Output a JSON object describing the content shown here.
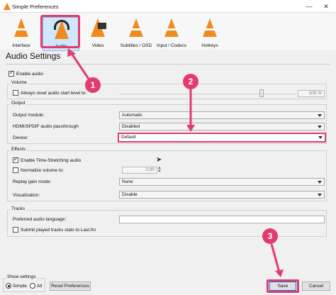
{
  "window": {
    "title": "Simple Preferences",
    "min_icon": "minimize-icon",
    "close_icon": "close-icon"
  },
  "toolbar": {
    "items": [
      {
        "label": "Interface",
        "icon": "interface-icon"
      },
      {
        "label": "Audio",
        "icon": "audio-icon"
      },
      {
        "label": "Video",
        "icon": "video-icon"
      },
      {
        "label": "Subtitles / OSD",
        "icon": "subtitles-icon"
      },
      {
        "label": "Input / Codecs",
        "icon": "input-codecs-icon"
      },
      {
        "label": "Hotkeys",
        "icon": "hotkeys-icon"
      }
    ],
    "selected": "Audio"
  },
  "page_title": "Audio Settings",
  "enable_audio": {
    "label": "Enable audio",
    "checked": true
  },
  "volume": {
    "group_label": "Volume",
    "reset_label": "Always reset audio start level to:",
    "reset_checked": false,
    "level": "100 %"
  },
  "output": {
    "group_label": "Output",
    "module_label": "Output module:",
    "module_value": "Automatic",
    "passthrough_label": "HDMI/SPDIF audio passthrough",
    "passthrough_value": "Disabled",
    "device_label": "Device:",
    "device_value": "Default"
  },
  "effects": {
    "group_label": "Effects",
    "stretch_label": "Enable Time-Stretching audio",
    "stretch_checked": true,
    "normalize_label": "Normalize volume to:",
    "normalize_checked": false,
    "normalize_value": "2.00",
    "replay_label": "Replay gain mode:",
    "replay_value": "None",
    "visualization_label": "Visualization:",
    "visualization_value": "Disable"
  },
  "tracks": {
    "group_label": "Tracks",
    "language_label": "Preferred audio language:",
    "language_value": "",
    "lastfm_label": "Submit played tracks stats to Last.fm",
    "lastfm_checked": false
  },
  "show_settings": {
    "label": "Show settings",
    "simple": "Simple",
    "all": "All",
    "selected": "Simple"
  },
  "buttons": {
    "reset": "Reset Preferences",
    "save": "Save",
    "cancel": "Cancel"
  },
  "callouts": [
    "1",
    "2",
    "3"
  ],
  "colors": {
    "accent": "#e23b6d",
    "vlc_orange": "#f08a1c",
    "selected_tab": "#cfe6fb"
  }
}
